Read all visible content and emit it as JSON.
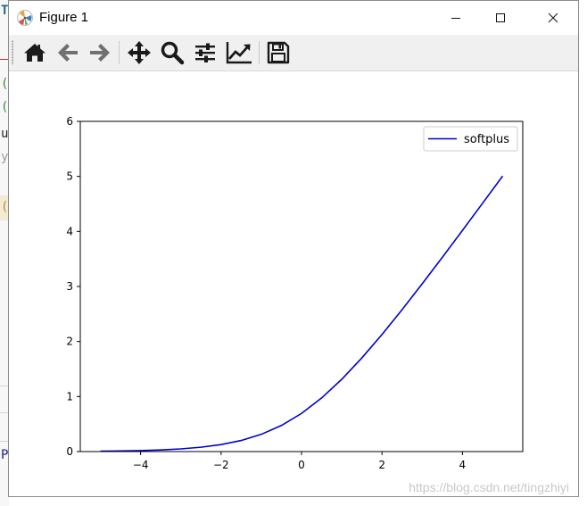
{
  "window": {
    "title": "Figure 1"
  },
  "background": {
    "marks": [
      "T",
      "(",
      "(",
      "u",
      "y",
      "(",
      "P"
    ]
  },
  "toolbar": {
    "tools": [
      {
        "name": "home-button",
        "icon": "home-icon"
      },
      {
        "name": "back-button",
        "icon": "arrow-left-icon"
      },
      {
        "name": "forward-button",
        "icon": "arrow-right-icon"
      },
      {
        "name": "pan-button",
        "icon": "move-icon"
      },
      {
        "name": "zoom-button",
        "icon": "magnifier-icon"
      },
      {
        "name": "subplots-button",
        "icon": "sliders-icon"
      },
      {
        "name": "axes-button",
        "icon": "line-chart-icon"
      },
      {
        "name": "save-button",
        "icon": "floppy-disk-icon"
      }
    ]
  },
  "watermark": "https://blog.csdn.net/tingzhiyi",
  "chart_data": {
    "type": "line",
    "function": "softplus",
    "xlim": [
      -5.5,
      5.5
    ],
    "ylim": [
      0,
      6
    ],
    "xticks": [
      -4,
      -2,
      0,
      2,
      4
    ],
    "xtick_labels": [
      "−4",
      "−2",
      "0",
      "2",
      "4"
    ],
    "yticks": [
      0,
      1,
      2,
      3,
      4,
      5,
      6
    ],
    "ytick_labels": [
      "0",
      "1",
      "2",
      "3",
      "4",
      "5",
      "6"
    ],
    "legend": {
      "position": "top-right",
      "entries": [
        "softplus"
      ]
    },
    "grid": false,
    "series": [
      {
        "name": "softplus",
        "color": "#0000cc",
        "x": [
          -5,
          -4.5,
          -4,
          -3.5,
          -3,
          -2.5,
          -2,
          -1.5,
          -1,
          -0.5,
          0,
          0.5,
          1,
          1.5,
          2,
          2.5,
          3,
          3.5,
          4,
          4.5,
          5
        ],
        "y": [
          0.0067,
          0.011,
          0.0181,
          0.0298,
          0.0486,
          0.0789,
          0.1269,
          0.2014,
          0.3133,
          0.4741,
          0.6931,
          0.9741,
          1.3133,
          1.7014,
          2.1269,
          2.5789,
          3.0486,
          3.5298,
          4.0181,
          4.511,
          5.0067
        ]
      }
    ]
  }
}
